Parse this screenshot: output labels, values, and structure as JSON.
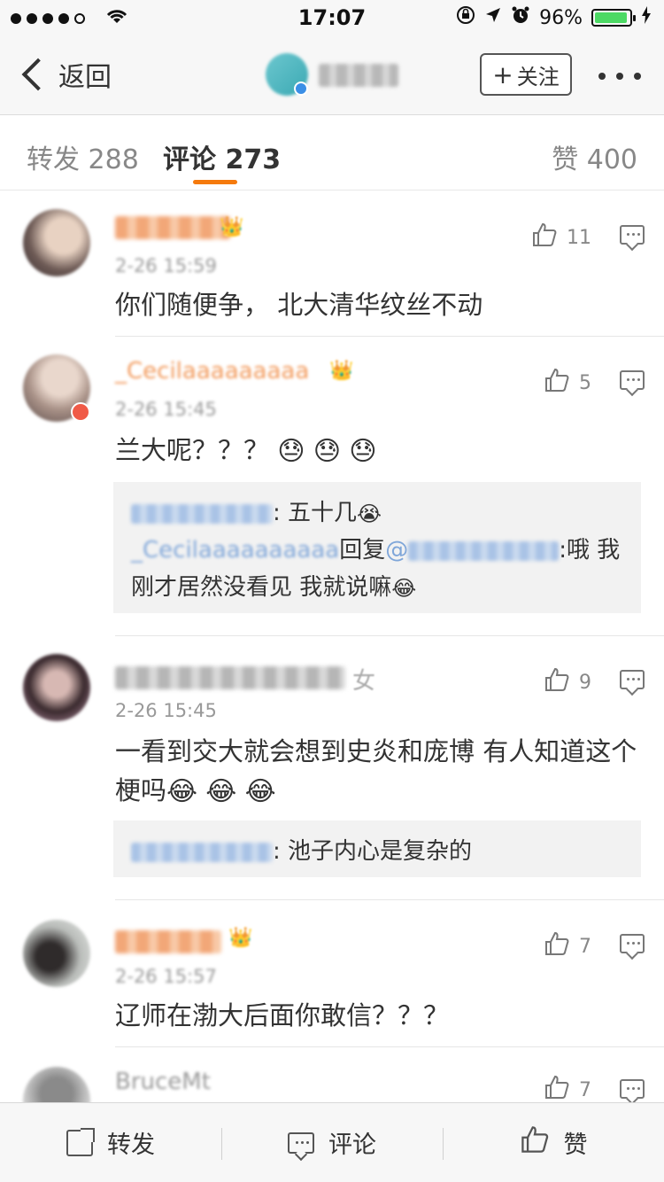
{
  "status_bar": {
    "time": "17:07",
    "battery_percent": "96%",
    "battery_level": 0.96
  },
  "nav": {
    "back_label": "返回",
    "follow_label": "关注"
  },
  "tabs": {
    "forward": "转发 288",
    "comment": "评论 273",
    "like": "赞 400"
  },
  "comments": [
    {
      "time": "2-26 15:59",
      "text": "你们随便争， 北大清华纹丝不动",
      "likes": "11",
      "replies": []
    },
    {
      "name": "_Cecilaaaaaaaaa",
      "time": "2-26 15:45",
      "text": "兰大呢？？？",
      "likes": "5",
      "emoji": [
        "😓",
        "😓",
        "😓"
      ],
      "replies": [
        {
          "text": ": 五十几",
          "emoji": "😭"
        },
        {
          "name": "_Cecilaaaaaaaaaa",
          "reply_word": "回复",
          "mention": "@",
          "text": ":哦 我刚才居然没看见 我就说嘛",
          "emoji": "😂"
        }
      ]
    },
    {
      "name_suffix": "女",
      "time": "2-26 15:45",
      "text": "一看到交大就会想到史炎和庞博  有人知道这个梗吗",
      "likes": "9",
      "emoji": [
        "😂",
        "😂",
        "😂"
      ],
      "replies": [
        {
          "text": ": 池子内心是复杂的"
        }
      ]
    },
    {
      "time": "2-26 15:57",
      "text": "辽师在渤大后面你敢信？？？",
      "likes": "7",
      "replies": []
    },
    {
      "name": "BruceMt",
      "likes": "7"
    }
  ],
  "bottom_bar": {
    "forward": "转发",
    "comment": "评论",
    "like": "赞"
  }
}
